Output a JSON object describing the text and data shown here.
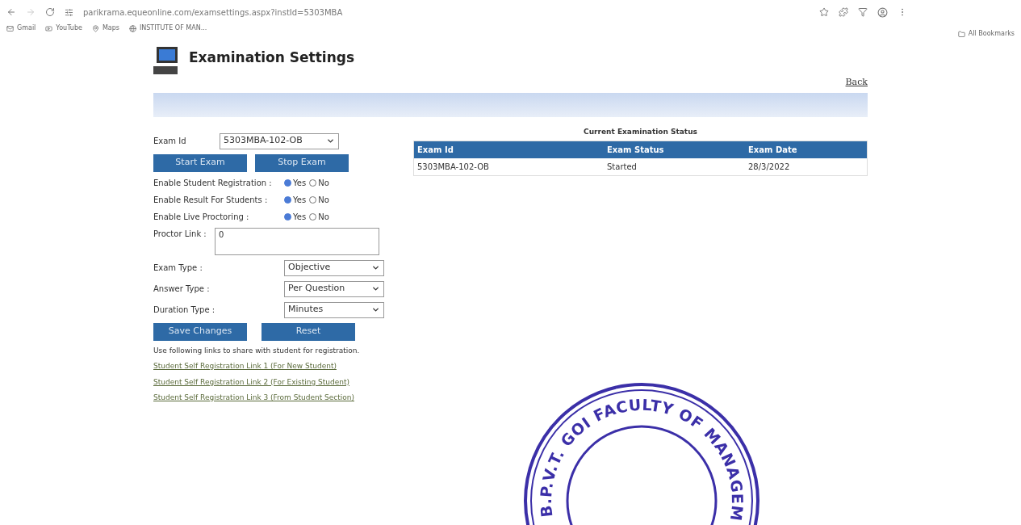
{
  "browser": {
    "url": "parikrama.equeonline.com/examsettings.aspx?instId=5303MBA",
    "bookmarks": [
      "Gmail",
      "YouTube",
      "Maps",
      "INSTITUTE OF MAN..."
    ],
    "all_bookmarks": "All Bookmarks"
  },
  "page": {
    "title": "Examination Settings",
    "back_link": "Back"
  },
  "form": {
    "exam_id": {
      "label": "Exam Id",
      "value": "5303MBA-102-OB"
    },
    "top_buttons": [
      "Start Exam",
      "Stop Exam"
    ],
    "toggles": [
      {
        "label": "Enable Student Registration :",
        "options": [
          {
            "label": "Yes",
            "selected": true
          },
          {
            "label": "No",
            "selected": false
          }
        ]
      },
      {
        "label": "Enable Result For Students :",
        "options": [
          {
            "label": "Yes",
            "selected": true
          },
          {
            "label": "No",
            "selected": false
          }
        ]
      },
      {
        "label": "Enable Live Proctoring :",
        "options": [
          {
            "label": "Yes",
            "selected": true
          },
          {
            "label": "No",
            "selected": false
          }
        ]
      }
    ],
    "proctor_link": {
      "label": "Proctor Link :",
      "value": "0"
    },
    "selects": [
      {
        "label": "Exam Type :",
        "value": "Objective"
      },
      {
        "label": "Answer Type :",
        "value": "Per Question"
      },
      {
        "label": "Duration Type :",
        "value": "Minutes"
      }
    ],
    "bottom_buttons": [
      "Save Changes",
      "Reset"
    ],
    "links_intro": "Use following links to share with student for registration.",
    "links": [
      "Student Self Registration Link 1 (For New Student)",
      "Student Self Registration Link 2 (For Existing Student)",
      "Student Self Registration Link 3 (From Student Section)"
    ]
  },
  "status": {
    "title": "Current Examination Status",
    "columns": [
      "Exam Id",
      "Exam Status",
      "Exam Date"
    ],
    "rows": [
      [
        "5303MBA-102-OB",
        "Started",
        "28/3/2022"
      ]
    ]
  },
  "stamp": {
    "text": "B.P.V.T. GOI FACULTY OF MANAGEM"
  }
}
